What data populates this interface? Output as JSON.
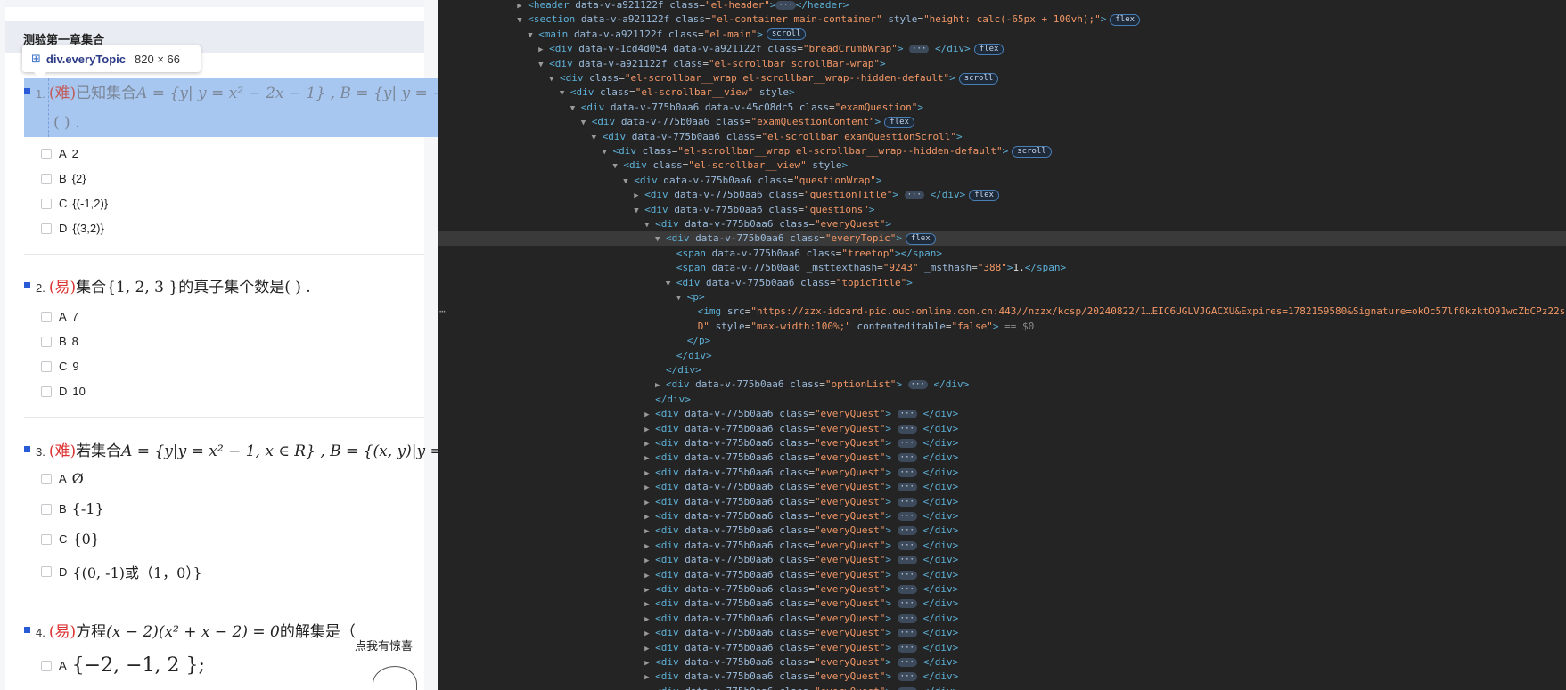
{
  "page": {
    "title": "测验第一章集合",
    "promo": "点我有惊喜"
  },
  "tooltip": {
    "icon": "flex-grid-icon",
    "name": "div.everyTopic",
    "size": "820 × 66"
  },
  "questions": [
    {
      "num": "1.",
      "difficulty": "(难)",
      "text": "已知集合",
      "math": "A = {y| y = x² − 2x − 1} , B = {y| y = −",
      "line2": "(         ) .",
      "options": [
        {
          "label": "A",
          "text": "2"
        },
        {
          "label": "B",
          "text": "{2}"
        },
        {
          "label": "C",
          "text": "{(-1,2)}"
        },
        {
          "label": "D",
          "text": "{(3,2)}"
        }
      ]
    },
    {
      "num": "2.",
      "difficulty": "(易)",
      "text": "集合",
      "math": "{1, 2, 3 }",
      "tail": "的真子集个数是(          ) .",
      "options": [
        {
          "label": "A",
          "text": "7"
        },
        {
          "label": "B",
          "text": "8"
        },
        {
          "label": "C",
          "text": "9"
        },
        {
          "label": "D",
          "text": "10"
        }
      ]
    },
    {
      "num": "3.",
      "difficulty": "(难)",
      "text": "若集合",
      "math": "A = {y|y = x² − 1, x ∈ R} , B = {(x, y)|y = x",
      "options": [
        {
          "label": "A",
          "text": "Ø"
        },
        {
          "label": "B",
          "text": "{-1}"
        },
        {
          "label": "C",
          "text": "{0}"
        },
        {
          "label": "D",
          "text": "{(0, -1)或（1，0）}"
        }
      ]
    },
    {
      "num": "4.",
      "difficulty": "(易)",
      "text": "方程",
      "math": "(x − 2)(x² + x − 2) = 0",
      "tail": "的解集是（",
      "options": [
        {
          "label": "A",
          "text": "{−2, −1, 2 };"
        }
      ]
    }
  ],
  "devtools": {
    "lines": [
      {
        "indent": 7,
        "arrow": "▶",
        "html": "<span class=\"tag\">&lt;header</span> <span class=\"attr\">data-v-a921122f</span> <span class=\"attr\">class</span>=<span class=\"val\">\"el-header\"</span><span class=\"tag\">&gt;</span><span class=\"ell\">···</span><span class=\"tag\">&lt;/header&gt;</span>"
      },
      {
        "indent": 7,
        "arrow": "▼",
        "html": "<span class=\"tag\">&lt;section</span> <span class=\"attr\">data-v-a921122f</span> <span class=\"attr\">class</span>=<span class=\"val\">\"el-container main-container\"</span> <span class=\"attr\">style</span>=<span class=\"val\">\"height: calc(-65px + 100vh);\"</span><span class=\"tag\">&gt;</span><span class=\"badge\">flex</span>"
      },
      {
        "indent": 8,
        "arrow": "▼",
        "html": "<span class=\"tag\">&lt;main</span> <span class=\"attr\">data-v-a921122f</span> <span class=\"attr\">class</span>=<span class=\"val\">\"el-main\"</span><span class=\"tag\">&gt;</span><span class=\"badge\">scroll</span>"
      },
      {
        "indent": 9,
        "arrow": "▶",
        "html": "<span class=\"tag\">&lt;div</span> <span class=\"attr\">data-v-1cd4d054</span> <span class=\"attr\">data-v-a921122f</span> <span class=\"attr\">class</span>=<span class=\"val\">\"breadCrumbWrap\"</span><span class=\"tag\">&gt;</span> <span class=\"ell\">···</span> <span class=\"tag\">&lt;/div&gt;</span><span class=\"badge\">flex</span>"
      },
      {
        "indent": 9,
        "arrow": "▼",
        "html": "<span class=\"tag\">&lt;div</span> <span class=\"attr\">data-v-a921122f</span> <span class=\"attr\">class</span>=<span class=\"val\">\"el-scrollbar scrollBar-wrap\"</span><span class=\"tag\">&gt;</span>"
      },
      {
        "indent": 10,
        "arrow": "▼",
        "html": "<span class=\"tag\">&lt;div</span> <span class=\"attr\">class</span>=<span class=\"val\">\"el-scrollbar__wrap el-scrollbar__wrap--hidden-default\"</span><span class=\"tag\">&gt;</span><span class=\"badge\">scroll</span>"
      },
      {
        "indent": 11,
        "arrow": "▼",
        "html": "<span class=\"tag\">&lt;div</span> <span class=\"attr\">class</span>=<span class=\"val\">\"el-scrollbar__view\"</span> <span class=\"attr\">style</span><span class=\"tag\">&gt;</span>"
      },
      {
        "indent": 12,
        "arrow": "▼",
        "html": "<span class=\"tag\">&lt;div</span> <span class=\"attr\">data-v-775b0aa6</span> <span class=\"attr\">data-v-45c08dc5</span> <span class=\"attr\">class</span>=<span class=\"val\">\"examQuestion\"</span><span class=\"tag\">&gt;</span>"
      },
      {
        "indent": 13,
        "arrow": "▼",
        "html": "<span class=\"tag\">&lt;div</span> <span class=\"attr\">data-v-775b0aa6</span> <span class=\"attr\">class</span>=<span class=\"val\">\"examQuestionContent\"</span><span class=\"tag\">&gt;</span><span class=\"badge\">flex</span>"
      },
      {
        "indent": 14,
        "arrow": "▼",
        "html": "<span class=\"tag\">&lt;div</span> <span class=\"attr\">data-v-775b0aa6</span> <span class=\"attr\">class</span>=<span class=\"val\">\"el-scrollbar examQuestionScroll\"</span><span class=\"tag\">&gt;</span>"
      },
      {
        "indent": 15,
        "arrow": "▼",
        "html": "<span class=\"tag\">&lt;div</span> <span class=\"attr\">class</span>=<span class=\"val\">\"el-scrollbar__wrap el-scrollbar__wrap--hidden-default\"</span><span class=\"tag\">&gt;</span><span class=\"badge\">scroll</span>"
      },
      {
        "indent": 16,
        "arrow": "▼",
        "html": "<span class=\"tag\">&lt;div</span> <span class=\"attr\">class</span>=<span class=\"val\">\"el-scrollbar__view\"</span> <span class=\"attr\">style</span><span class=\"tag\">&gt;</span>"
      },
      {
        "indent": 17,
        "arrow": "▼",
        "html": "<span class=\"tag\">&lt;div</span> <span class=\"attr\">data-v-775b0aa6</span> <span class=\"attr\">class</span>=<span class=\"val\">\"questionWrap\"</span><span class=\"tag\">&gt;</span>"
      },
      {
        "indent": 18,
        "arrow": "▶",
        "html": "<span class=\"tag\">&lt;div</span> <span class=\"attr\">data-v-775b0aa6</span> <span class=\"attr\">class</span>=<span class=\"val\">\"questionTitle\"</span><span class=\"tag\">&gt;</span> <span class=\"ell\">···</span> <span class=\"tag\">&lt;/div&gt;</span><span class=\"badge\">flex</span>"
      },
      {
        "indent": 18,
        "arrow": "▼",
        "html": "<span class=\"tag\">&lt;div</span> <span class=\"attr\">data-v-775b0aa6</span> <span class=\"attr\">class</span>=<span class=\"val\">\"questions\"</span><span class=\"tag\">&gt;</span>"
      },
      {
        "indent": 19,
        "arrow": "▼",
        "html": "<span class=\"tag\">&lt;div</span> <span class=\"attr\">data-v-775b0aa6</span> <span class=\"attr\">class</span>=<span class=\"val\">\"everyQuest\"</span><span class=\"tag\">&gt;</span>"
      },
      {
        "indent": 20,
        "arrow": "▼",
        "sel": true,
        "html": "<span class=\"tag\">&lt;div</span> <span class=\"attr\">data-v-775b0aa6</span> <span class=\"attr\">class</span>=<span class=\"val\">\"everyTopic\"</span><span class=\"tag\">&gt;</span><span class=\"badge\">flex</span>"
      },
      {
        "indent": 21,
        "arrow": "",
        "html": "<span class=\"tag\">&lt;span</span> <span class=\"attr\">data-v-775b0aa6</span> <span class=\"attr\">class</span>=<span class=\"val\">\"treetop\"</span><span class=\"tag\">&gt;&lt;/span&gt;</span>"
      },
      {
        "indent": 21,
        "arrow": "",
        "html": "<span class=\"tag\">&lt;span</span> <span class=\"attr\">data-v-775b0aa6</span> <span class=\"attr\">_msttexthash</span>=<span class=\"val\">\"9243\"</span> <span class=\"attr\">_msthash</span>=<span class=\"val\">\"388\"</span><span class=\"tag\">&gt;</span><span class=\"txt\">1.</span><span class=\"tag\">&lt;/span&gt;</span>"
      },
      {
        "indent": 21,
        "arrow": "▼",
        "html": "<span class=\"tag\">&lt;div</span> <span class=\"attr\">data-v-775b0aa6</span> <span class=\"attr\">class</span>=<span class=\"val\">\"topicTitle\"</span><span class=\"tag\">&gt;</span>"
      },
      {
        "indent": 22,
        "arrow": "▼",
        "html": "<span class=\"tag\">&lt;p&gt;</span>"
      },
      {
        "indent": 23,
        "arrow": "",
        "dots": true,
        "html": "<span class=\"tag\">&lt;img</span> <span class=\"attr\">src</span>=<span class=\"val\">\"https://zzx-idcard-pic.ouc-online.com.cn:443//nzzx/kcsp/20240822/1…EIC6UGLVJGACXU&amp;Expires=1782159580&amp;Signature=okOc57lf0kzktO91wcZbCPz22ss%</span>"
      },
      {
        "indent": 23,
        "arrow": "",
        "html": "<span class=\"val\">D\"</span> <span class=\"attr\">style</span>=<span class=\"val\">\"max-width:100%;\"</span> <span class=\"attr\">contenteditable</span>=<span class=\"val\">\"false\"</span><span class=\"tag\">&gt;</span> <span class=\"eq\">== $0</span>"
      },
      {
        "indent": 22,
        "arrow": "",
        "html": "<span class=\"tag\">&lt;/p&gt;</span>"
      },
      {
        "indent": 21,
        "arrow": "",
        "html": "<span class=\"tag\">&lt;/div&gt;</span>"
      },
      {
        "indent": 20,
        "arrow": "",
        "html": "<span class=\"tag\">&lt;/div&gt;</span>"
      },
      {
        "indent": 20,
        "arrow": "▶",
        "html": "<span class=\"tag\">&lt;div</span> <span class=\"attr\">data-v-775b0aa6</span> <span class=\"attr\">class</span>=<span class=\"val\">\"optionList\"</span><span class=\"tag\">&gt;</span> <span class=\"ell\">···</span> <span class=\"tag\">&lt;/div&gt;</span>"
      },
      {
        "indent": 19,
        "arrow": "",
        "html": "<span class=\"tag\">&lt;/div&gt;</span>"
      }
    ],
    "collapsed_line": "<span class=\"tag\">&lt;div</span> <span class=\"attr\">data-v-775b0aa6</span> <span class=\"attr\">class</span>=<span class=\"val\">\"everyQuest\"</span><span class=\"tag\">&gt;</span> <span class=\"ell\">···</span> <span class=\"tag\">&lt;/div&gt;</span>",
    "collapsed_count": 20,
    "collapsed_indent": 19
  }
}
